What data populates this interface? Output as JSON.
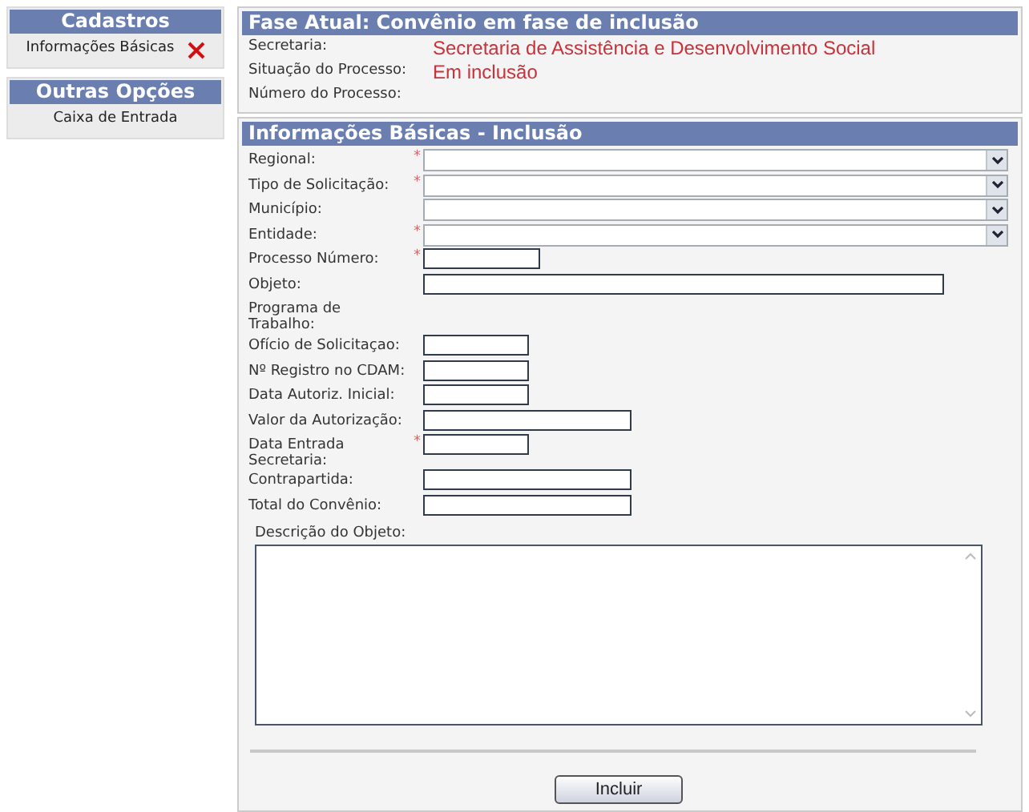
{
  "sidebar": {
    "sections": [
      {
        "title": "Cadastros",
        "items": [
          {
            "label": "Informações Básicas",
            "removable": true
          }
        ]
      },
      {
        "title": "Outras Opções",
        "items": [
          {
            "label": "Caixa de Entrada",
            "removable": false
          }
        ]
      }
    ]
  },
  "phase": {
    "title": "Fase Atual: Convênio em fase de inclusão",
    "rows": [
      {
        "label": "Secretaria:",
        "value": "Secretaria de Assistência e Desenvolvimento Social"
      },
      {
        "label": "Situação do Processo:",
        "value": "Em inclusão"
      },
      {
        "label": "Número do Processo:"
      }
    ]
  },
  "form": {
    "title": "Informações Básicas - Inclusão",
    "fields": [
      {
        "label": "Regional:",
        "kind": "select",
        "required": true
      },
      {
        "label": "Tipo de Solicitação:",
        "kind": "select",
        "required": true
      },
      {
        "label": "Município:",
        "kind": "select",
        "required": false
      },
      {
        "label": "Entidade:",
        "kind": "select",
        "required": true
      },
      {
        "label": "Processo Número:",
        "kind": "short",
        "required": true
      },
      {
        "label": "Objeto:",
        "kind": "long",
        "required": false
      },
      {
        "label": "Programa de Trabalho:",
        "kind": "none",
        "required": false
      },
      {
        "label": "Ofício de Solicitaçao:",
        "kind": "small",
        "required": false
      },
      {
        "label": "Nº Registro no CDAM:",
        "kind": "small",
        "required": false
      },
      {
        "label": "Data Autoriz. Inicial:",
        "kind": "small",
        "required": false
      },
      {
        "label": "Valor da Autorização:",
        "kind": "medium",
        "required": false
      },
      {
        "label": "Data Entrada Secretaria:",
        "kind": "small",
        "required": true
      },
      {
        "label": "Contrapartida:",
        "kind": "medium",
        "required": false
      },
      {
        "label": "Total do Convênio:",
        "kind": "medium",
        "required": false
      }
    ],
    "required_mark": "*",
    "description_label": "Descrição do Objeto:",
    "submit": "Incluir"
  }
}
